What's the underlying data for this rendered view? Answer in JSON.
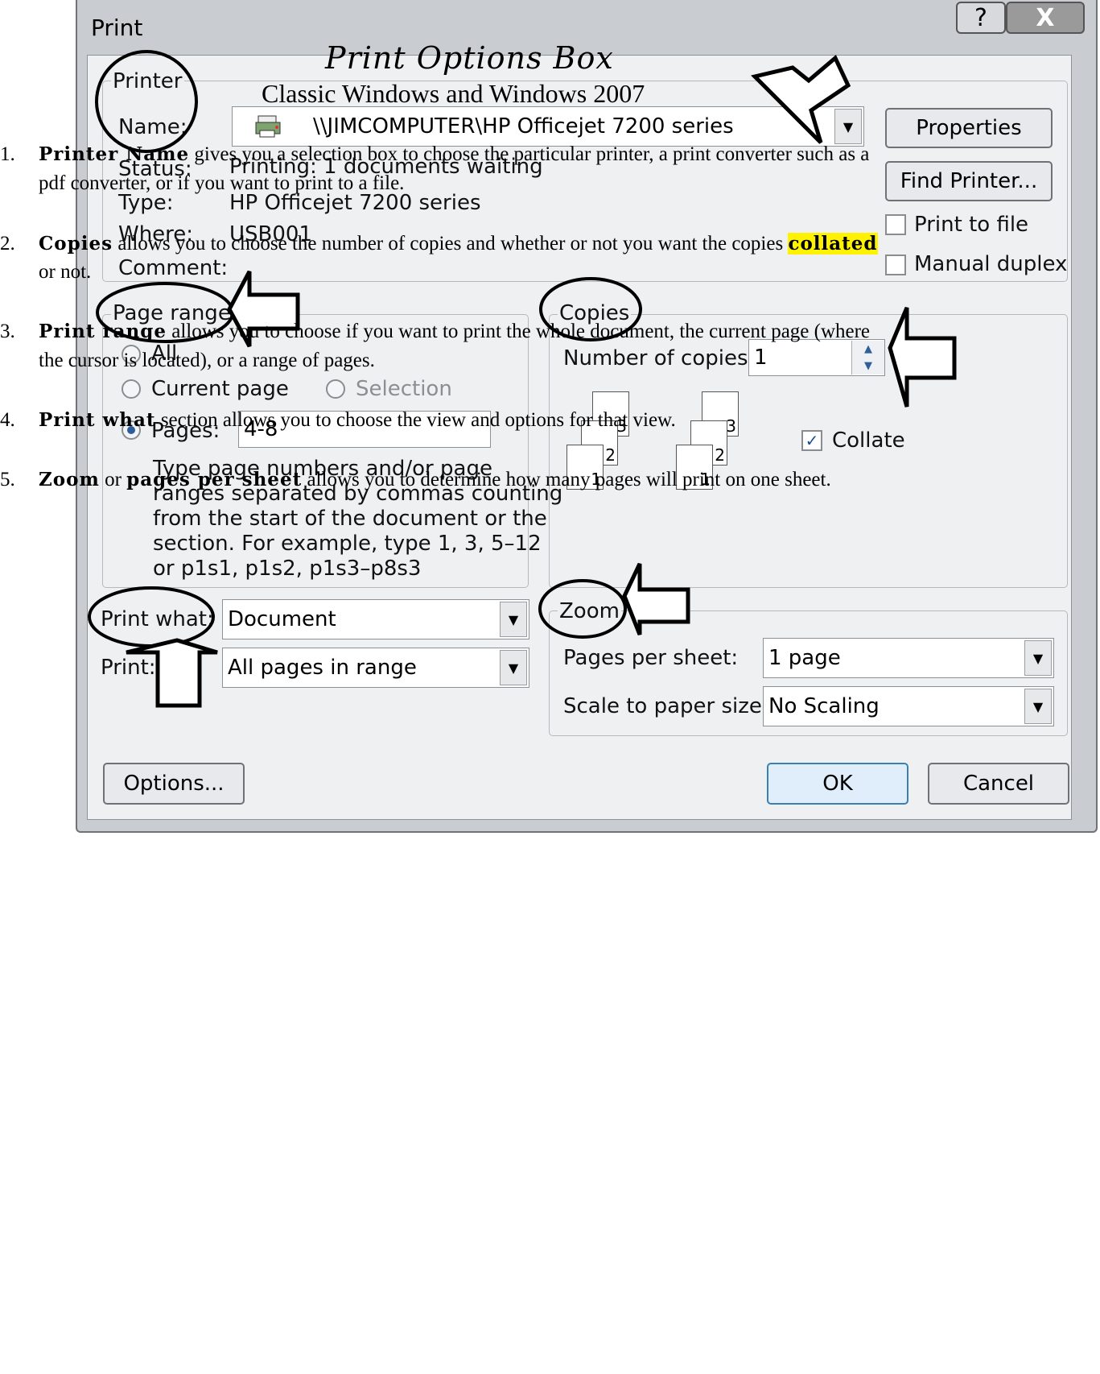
{
  "dialog": {
    "title": "Print",
    "help_glyph": "?",
    "close_glyph": "X",
    "printer": {
      "group_label": "Printer",
      "name_label": "Name:",
      "name_value": "\\\\JIMCOMPUTER\\HP Officejet 7200 series",
      "status_label": "Status:",
      "status_value": "Printing: 1 documents waiting",
      "type_label": "Type:",
      "type_value": "HP Officejet 7200 series",
      "where_label": "Where:",
      "where_value": "USB001",
      "comment_label": "Comment:",
      "properties_button": "Properties",
      "find_printer_button": "Find Printer...",
      "print_to_file_label": "Print to file",
      "manual_duplex_label": "Manual duplex"
    },
    "page_range": {
      "group_label": "Page range",
      "all_label": "All",
      "current_page_label": "Current page",
      "selection_label": "Selection",
      "pages_label": "Pages:",
      "pages_value": "4-8",
      "help_line1": "Type page numbers and/or page",
      "help_line2": "ranges separated by commas counting",
      "help_line3": "from the start of the document or the",
      "help_line4": "section. For example, type 1, 3, 5–12",
      "help_line5": "or p1s1, p1s2, p1s3–p8s3"
    },
    "copies": {
      "group_label": "Copies",
      "number_label": "Number of copies:",
      "number_value": "1",
      "collate_label": "Collate",
      "collate_checked": true,
      "page_icons": [
        "1",
        "2",
        "3",
        "1",
        "2",
        "3"
      ]
    },
    "print_what": {
      "label": "Print what:",
      "value": "Document",
      "print_label": "Print:",
      "print_value": "All pages in range"
    },
    "zoom": {
      "group_label": "Zoom",
      "pages_per_sheet_label": "Pages per sheet:",
      "pages_per_sheet_value": "1 page",
      "scale_label": "Scale to paper size:",
      "scale_value": "No Scaling"
    },
    "options_button": "Options...",
    "ok_button": "OK",
    "cancel_button": "Cancel"
  },
  "overlay": {
    "title": "Print Options Box",
    "subtitle": "Classic Windows and Windows 2007",
    "items": [
      {
        "num": "1.",
        "bold": "Printer Name",
        "rest": " gives you a selection box to choose the particular printer, a print converter such as a",
        "line2": "pdf converter, or if you want to print to a file."
      },
      {
        "num": "2.",
        "bold": "Copies",
        "rest": " allows you to choose the number of copies and whether or not you want the copies ",
        "highlight": "collated",
        "line2": "or not."
      },
      {
        "num": "3.",
        "bold": "Print range",
        "rest": " allows you to choose if you want to print the whole document, the current page (where",
        "line2": "the cursor is located), or a range of pages."
      },
      {
        "num": "4.",
        "bold": "Print what",
        "rest": " section allows you to choose the view and options for that view."
      },
      {
        "num": "5.",
        "bold": "Zoom",
        "rest": " or ",
        "bold2": "pages per sheet",
        "rest2": " allows you to determine how many pages will print on one sheet."
      }
    ]
  }
}
